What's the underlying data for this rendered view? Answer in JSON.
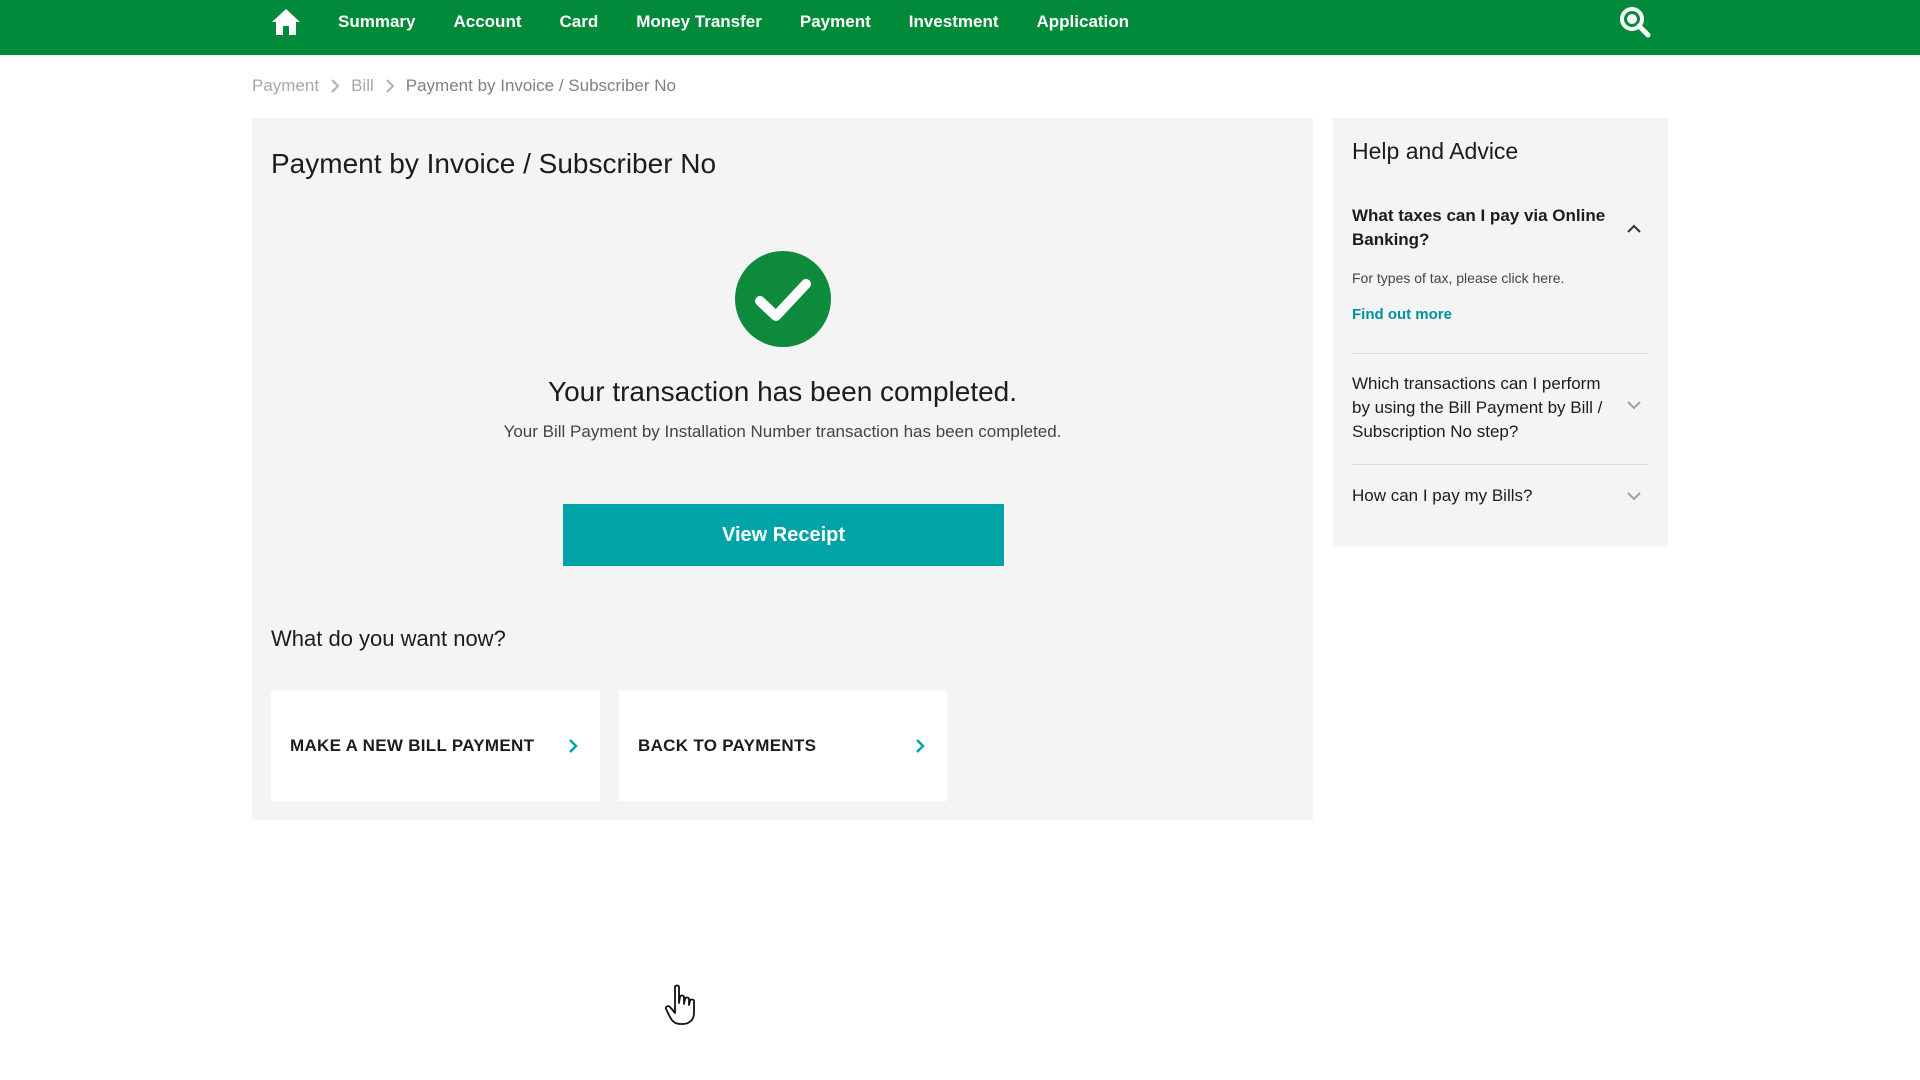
{
  "nav": {
    "items": [
      {
        "label": "Summary"
      },
      {
        "label": "Account"
      },
      {
        "label": "Card"
      },
      {
        "label": "Money Transfer"
      },
      {
        "label": "Payment"
      },
      {
        "label": "Investment"
      },
      {
        "label": "Application"
      }
    ],
    "icons": {
      "home": "home-icon",
      "search": "search-icon"
    }
  },
  "breadcrumb": {
    "items": [
      "Payment",
      "Bill",
      "Payment by Invoice / Subscriber No"
    ]
  },
  "main": {
    "title": "Payment by Invoice / Subscriber No",
    "success_title": "Your transaction has been completed.",
    "success_subtitle": "Your Bill Payment by Installation Number transaction has been completed.",
    "receipt_button": "View Receipt",
    "next_heading": "What do you want now?",
    "actions": [
      {
        "label": "MAKE A NEW BILL PAYMENT"
      },
      {
        "label": "BACK TO PAYMENTS"
      }
    ]
  },
  "help": {
    "title": "Help and Advice",
    "faqs": [
      {
        "question": "What taxes can I pay via Online Banking?",
        "expanded": true,
        "body": "For types of tax, please click here.",
        "link": "Find out more"
      },
      {
        "question": "Which transactions can I perform by using the Bill Payment by Bill / Subscription No step?",
        "expanded": false
      },
      {
        "question": "How can I pay my Bills?",
        "expanded": false
      }
    ]
  },
  "colors": {
    "nav_bg": "#008a3a",
    "success": "#0e8a3c",
    "accent": "#00a3a6",
    "link": "#00919a",
    "panel_bg": "#f4f4f4"
  }
}
